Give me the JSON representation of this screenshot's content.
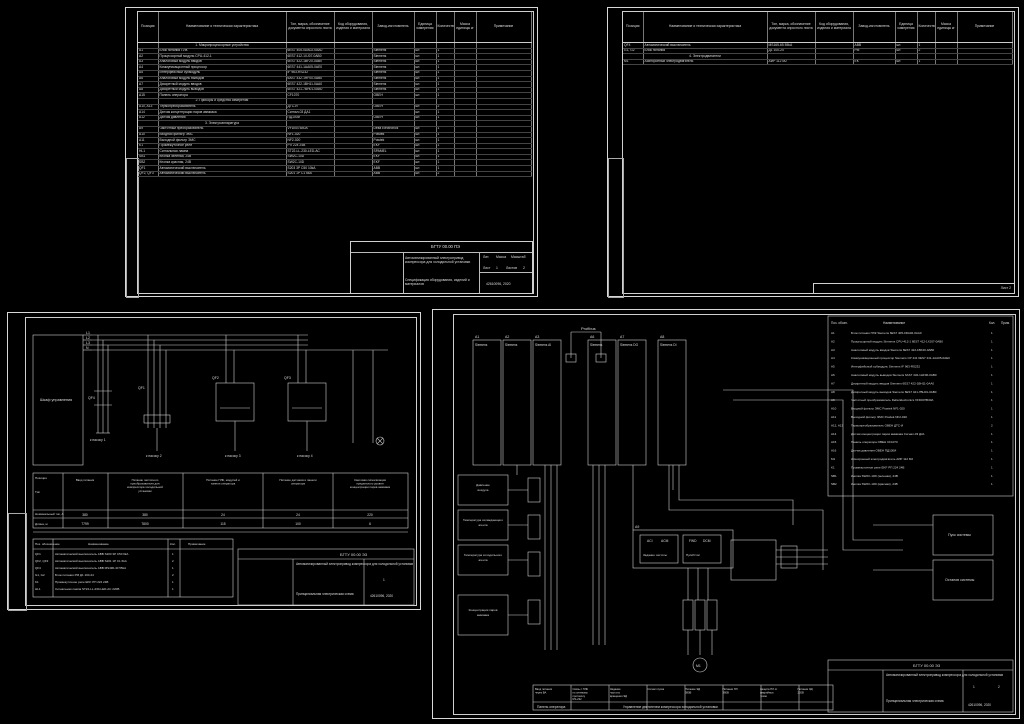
{
  "spec_sheet_1": {
    "headers": [
      "Позиция",
      "Наименование и техническая характеристика",
      "Тип, марка, обозначение документа опросного листа",
      "Код оборудования, изделия и материала",
      "Завод-изготовитель",
      "Единица измерения",
      "Количество",
      "Масса единицы кг",
      "Примечание"
    ],
    "rows": [
      {
        "type": "sec",
        "name": "1. Микропроцессорные устройства"
      },
      {
        "pos": "A1",
        "name": "Блок питания ПЛК",
        "type_mark": "6ES7 405-0DA02-0AA0",
        "maker": "Siemens",
        "unit": "шт.",
        "qty": "1"
      },
      {
        "pos": "A2",
        "name": "Процессорный модуль CPU-412-1",
        "type_mark": "6ES7 412-1XJ07-0AB0",
        "maker": "Siemens",
        "unit": "шт.",
        "qty": "1"
      },
      {
        "pos": "A3",
        "name": "Аналоговый модуль вводов",
        "type_mark": "6ES7 422-1BF20-0AB0",
        "maker": "Siemens",
        "unit": "шт.",
        "qty": "1"
      },
      {
        "pos": "A4",
        "name": "Коммуникационный процессор",
        "type_mark": "6ES7 441-1AA05-0AE0",
        "maker": "Siemens",
        "unit": "шт.",
        "qty": "1"
      },
      {
        "pos": "A5",
        "name": "Интерфейсный субмодуль",
        "type_mark": "IF 963-RS232",
        "maker": "Siemens",
        "unit": "шт.",
        "qty": "1"
      },
      {
        "pos": "A6",
        "name": "Аналоговый модуль выводов",
        "type_mark": "6AS7 432-1HF00-0AB0",
        "maker": "Siemens",
        "unit": "шт.",
        "qty": "1"
      },
      {
        "pos": "A7",
        "name": "Дискретный модуль вводов",
        "type_mark": "6ES7 422-1BH11-0AA0",
        "maker": "Siemens",
        "unit": "шт.",
        "qty": "1"
      },
      {
        "pos": "A8",
        "name": "Дискретный модуль выводов",
        "type_mark": "6ES7 421-7BH01-0AB0",
        "maker": "Siemens",
        "unit": "шт.",
        "qty": "1"
      },
      {
        "pos": "A15",
        "name": "Панель оператора",
        "type_mark": "CF1070",
        "maker": "OBEH",
        "unit": "шт.",
        "qty": "1"
      },
      {
        "type": "sec",
        "name": "2. Приборы и средства измерения"
      },
      {
        "pos": "A10, A13",
        "name": "Термопреобразователь",
        "type_mark": "ДТС-И",
        "maker": "OBEH",
        "unit": "шт.",
        "qty": "2"
      },
      {
        "pos": "A14",
        "name": "Датчик концентрации паров аммиака",
        "type_mark": "Сигнал-03 ДА1",
        "maker": "",
        "unit": "шт.",
        "qty": "1"
      },
      {
        "pos": "A12",
        "name": "Датчик давления",
        "type_mark": "ПД100И",
        "maker": "OBEH",
        "unit": "шт.",
        "qty": "1"
      },
      {
        "type": "sec",
        "name": "3. Электроаппаратура"
      },
      {
        "pos": "A9",
        "name": "Частотный преобразователь",
        "type_mark": "VFD007B40A",
        "maker": "Delta Electronics",
        "unit": "шт.",
        "qty": "1"
      },
      {
        "pos": "A10",
        "name": "Входной фильтр ЭМС",
        "type_mark": "NF1-020",
        "maker": "Powtek",
        "unit": "шт.",
        "qty": "1"
      },
      {
        "pos": "A11",
        "name": "Выходной фильтр ЭМС",
        "type_mark": "NF2-020",
        "maker": "Powtek",
        "unit": "шт.",
        "qty": "1"
      },
      {
        "pos": "K1",
        "name": "Промежуточное реле",
        "type_mark": "РП 224 24В",
        "maker": "EKF",
        "unit": "шт.",
        "qty": "1"
      },
      {
        "pos": "HL1",
        "name": "Сигнальная лампа",
        "type_mark": "ST22-LL-230-LED-AC",
        "maker": "SPAMEL",
        "unit": "шт.",
        "qty": "1"
      },
      {
        "pos": "SB1",
        "name": "Кнопка зеленая, 24В",
        "type_mark": "SW2C-10D",
        "maker": "EKF",
        "unit": "шт.",
        "qty": "1"
      },
      {
        "pos": "SB2",
        "name": "Кнопка красная, 24В",
        "type_mark": "SW2C-10D",
        "maker": "EKF",
        "unit": "шт.",
        "qty": "1"
      },
      {
        "pos": "QF1",
        "name": "Автоматический выключатель",
        "type_mark": "S203 3P C50 10kA",
        "maker": "ABB",
        "unit": "шт.",
        "qty": "1"
      },
      {
        "pos": "QF2, QF3",
        "name": "Автоматический выключатель",
        "type_mark": "S201 1P C1 6kA",
        "maker": "ABB",
        "unit": "шт.",
        "qty": "2"
      }
    ],
    "stamp": {
      "code": "БГТУ 00.00 ПЭ",
      "title": "Автоматизированный электропривод компрессора для холодильной установки",
      "doc": "Спецификация оборудования, изделий и материалов",
      "group": "42610096, 2020",
      "sheet_label": "Лист",
      "sheets_label": "Листов",
      "stage": "Лит.",
      "mass": "Масса",
      "scale": "Масштаб",
      "sheet": "1",
      "sheets": "2"
    }
  },
  "spec_sheet_2": {
    "rows": [
      {
        "pos": "QF4",
        "name": "Автоматический выключатель",
        "type_mark": "MS165-65 55kA",
        "maker": "ABB",
        "unit": "шт.",
        "qty": "1"
      },
      {
        "pos": "G1, G2",
        "name": "Блок питания",
        "type_mark": "Д1 100-24",
        "maker": "РМ",
        "unit": "шт.",
        "qty": "2"
      },
      {
        "type": "sec",
        "name": "4. Электродвигатели"
      },
      {
        "pos": "M1",
        "name": "Асинхронный электродвигатель",
        "type_mark": "АИР 112 М2",
        "maker": "ЕК",
        "unit": "шт.",
        "qty": "1"
      }
    ],
    "sheet_label": "Лист 2"
  },
  "power_sheet": {
    "buses": [
      "L1",
      "L2",
      "L3",
      "N"
    ],
    "block_label": "Шкаф управления",
    "branches": [
      {
        "label": "QF4",
        "to": "к насосу 1"
      },
      {
        "label": "QF1",
        "to": "к насосу 2"
      },
      {
        "label": "QF2",
        "to": "к насосу 3"
      },
      {
        "label": "QF3",
        "to": "к насосу 4"
      }
    ],
    "table": {
      "row_headers": [
        "Позиция",
        "Тип",
        "Номинальный ток, А",
        "Длина, м"
      ],
      "columns": [
        "Ввод питания",
        "Питание частотного преобразователя для компрессора холодильной установки",
        "Питание ПЛК, модулей и панели оператора",
        "Питание датчиков и панели оператора",
        "Световая сигнализация предельного уровня концентрации паров аммиака"
      ],
      "values": [
        [
          "380",
          "380",
          "24",
          "24",
          "220"
        ],
        [
          "7799",
          "7800",
          "115",
          "100",
          "6"
        ]
      ]
    },
    "legend": [
      {
        "pos": "QF1",
        "name": "Автоматический выключатель ABB S203 3P C50 6kA",
        "qty": "1"
      },
      {
        "pos": "QF2, QF3",
        "name": "Автоматический выключатель ABB S201 1P C1 6kA",
        "qty": "2"
      },
      {
        "pos": "QF4",
        "name": "Автоматический выключатель ABB MS496-40 55kA",
        "qty": "1"
      },
      {
        "pos": "G1, G2",
        "name": "Блок питания РМ Д1 100-24",
        "qty": "2"
      },
      {
        "pos": "K1",
        "name": "Промежуточное реле EKF РП 224 24В",
        "qty": "1"
      },
      {
        "pos": "HL1",
        "name": "Сигнальная лампа ST22-LL-230-LED-AC 220В",
        "qty": "1"
      }
    ],
    "legend_headers": [
      "Поз. обозначение",
      "Наименование",
      "Кол.",
      "Примечание"
    ],
    "stamp": {
      "code": "БГТУ 00.00 Э3",
      "title": "Автоматизированный электропривод компрессора для холодильной установки",
      "doc": "Принципиальная электрическая схема",
      "group": "42610096, 2020",
      "sheet": "1"
    }
  },
  "control_sheet": {
    "profibus_label": "Profibus",
    "racks": [
      {
        "id": "A1",
        "brand": "Siemens"
      },
      {
        "id": "A2",
        "brand": "Siemens"
      },
      {
        "id": "A3",
        "brand": "Siemens AI"
      },
      {
        "id": "A6",
        "brand": "Siemens"
      },
      {
        "id": "A7",
        "brand": "Siemens DO"
      },
      {
        "id": "A8",
        "brand": "Siemens DI"
      }
    ],
    "sensor_blocks": [
      "Давление воздуха",
      "Температура охлаждающего агента",
      "Температура холодильного агента",
      "Концентрация паров аммиака"
    ],
    "inverter": {
      "id": "A9",
      "labels": [
        "ACI",
        "ACM",
        "FWD",
        "DCM"
      ],
      "sub": [
        "Задание частоты",
        "Пуск/Стоп"
      ]
    },
    "motor": "M1",
    "right_boxes": [
      "Пуск системы",
      "Останов системы"
    ],
    "bottom_cells": [
      "Ввод питания через ВА",
      "Связь с ПЛК по сетевому протоколу RS-232",
      "Задание частоты вращения ЭД",
      "Сигнал пуска",
      "Питание ЭД 380В",
      "Питание ПЛ 380В",
      "Защита ПЛ от аварийных токов",
      "Питание ЭД 220В"
    ],
    "bottom_cells_sub": [
      "Панель оператора",
      "Управление двигателем компрессора холодильной установки"
    ],
    "elements": [
      {
        "pos": "A1",
        "name": "Блок питания ПЛК Siemens 6ES7 405-0DA02-0AA0",
        "qty": "1"
      },
      {
        "pos": "A2",
        "name": "Процессорный модуль Siemens CPU-412-1 6ES7 412-1XJ07-0AB0",
        "qty": "1"
      },
      {
        "pos": "A3",
        "name": "Аналоговый модуль вводов Siemens 6ES7 422-1BF20-0AB0",
        "qty": "1"
      },
      {
        "pos": "A4",
        "name": "Коммуникационный процессор Siemens CP 441 6ES7 441-1AA05-0AE0",
        "qty": "1"
      },
      {
        "pos": "A5",
        "name": "Интерфейсный субмодуль Siemens IF 963-RS232",
        "qty": "1"
      },
      {
        "pos": "A6",
        "name": "Аналоговый модуль выводов Siemens 6AS7 432-1HF00-0AB0",
        "qty": "1"
      },
      {
        "pos": "A7",
        "name": "Дискретный модуль вводов Siemens 6ES7 422-1BH11-0AA0",
        "qty": "1"
      },
      {
        "pos": "A8",
        "name": "Дискретный модуль выводов Siemens 6ES7 421-7BH01-0AB0",
        "qty": "1"
      },
      {
        "pos": "A9",
        "name": "Частотный преобразователь Delta Electronics VFD007B40A",
        "qty": "1"
      },
      {
        "pos": "A10",
        "name": "Входной фильтр ЭМС Powtek NF1-020",
        "qty": "1"
      },
      {
        "pos": "A11",
        "name": "Выходной фильтр ЭМС Powtek NF2-020",
        "qty": "1"
      },
      {
        "pos": "A12, A13",
        "name": "Термопреобразователь OBEH ДТС-И",
        "qty": "2"
      },
      {
        "pos": "A14",
        "name": "Датчик концентрации паров аммиака Сигнал-03 ДА1",
        "qty": "1"
      },
      {
        "pos": "A15",
        "name": "Панель оператора OBEH CF1070",
        "qty": "1"
      },
      {
        "pos": "A16",
        "name": "Датчик давления OBEH ПД100И",
        "qty": "1"
      },
      {
        "pos": "M1",
        "name": "Асинхронный электродвигатель АИР 112 М2",
        "qty": "1"
      },
      {
        "pos": "K1",
        "name": "Промежуточное реле EKF РП 224 24В",
        "qty": "1"
      },
      {
        "pos": "SB1",
        "name": "Кнопка SW2C-10D (зеленая), 24В",
        "qty": "1"
      },
      {
        "pos": "SB2",
        "name": "Кнопка SW2C-10D (красная), 24В",
        "qty": "1"
      }
    ],
    "elements_headers": [
      "Поз. обозн.",
      "Наименование",
      "Кол.",
      "Прим."
    ],
    "stamp": {
      "code": "БГТУ 00.00 Э3",
      "title": "Автоматизированный электропривод компрессора для холодильной установки",
      "doc": "Принципиальная электрическая схема",
      "group": "42610096, 2020",
      "sheet": "1",
      "sheets": "2"
    }
  }
}
